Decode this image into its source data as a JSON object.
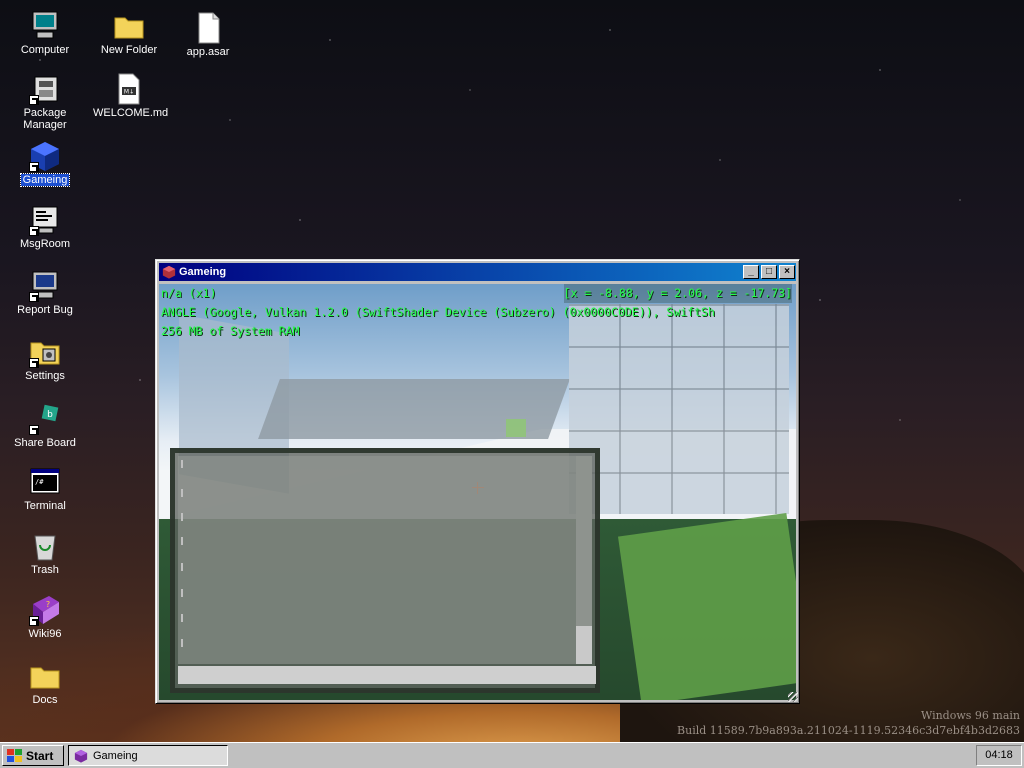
{
  "desktop": {
    "icons": [
      {
        "label": "Computer",
        "icon": "computer-icon"
      },
      {
        "label": "New Folder",
        "icon": "folder-icon"
      },
      {
        "label": "app.asar",
        "icon": "file-icon"
      },
      {
        "label": "Package Manager",
        "icon": "package-manager-icon"
      },
      {
        "label": "WELCOME.md",
        "icon": "markdown-file-icon"
      },
      {
        "label": "Gameing",
        "icon": "gameing-icon"
      },
      {
        "label": "MsgRoom",
        "icon": "msgroom-icon"
      },
      {
        "label": "Report Bug",
        "icon": "report-bug-icon"
      },
      {
        "label": "Settings",
        "icon": "settings-icon"
      },
      {
        "label": "Share Board",
        "icon": "share-board-icon"
      },
      {
        "label": "Terminal",
        "icon": "terminal-icon"
      },
      {
        "label": "Trash",
        "icon": "trash-icon"
      },
      {
        "label": "Wiki96",
        "icon": "wiki-book-icon"
      },
      {
        "label": "Docs",
        "icon": "folder-icon"
      }
    ],
    "watermark": {
      "line1": "Windows 96 main",
      "line2": "Build 11589.7b9a893a.211024-1119.52346c3d7ebf4b3d2683"
    }
  },
  "window": {
    "title": "Gameing",
    "buttons": {
      "minimize": "_",
      "maximize": "□",
      "close": "×"
    },
    "hud": {
      "line1": "n/a (x1)",
      "line2": "ANGLE (Google, Vulkan 1.2.0 (SwiftShader Device (Subzero) (0x0000C0DE)), SwiftSh",
      "line3": "256 MB of System RAM",
      "coords": "[x = -8.88, y = 2.06, z = -17.73]"
    },
    "console": {
      "input_value": ""
    }
  },
  "taskbar": {
    "start_label": "Start",
    "items": [
      {
        "label": "Gameing",
        "icon": "gameing-icon"
      }
    ],
    "clock": "04:18"
  },
  "colors": {
    "titlebar": "#000080",
    "hud_text": "#25ff4a",
    "selection": "#1c4fd0"
  }
}
